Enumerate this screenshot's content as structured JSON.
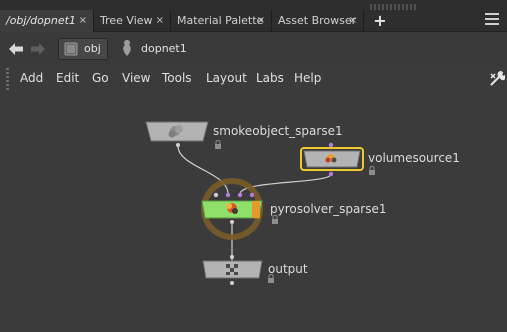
{
  "tabs": [
    {
      "label": "/obj/dopnet1",
      "close": "×",
      "active": true
    },
    {
      "label": "Tree View",
      "close": "×",
      "active": false
    },
    {
      "label": "Material Palette",
      "close": "×",
      "active": false
    },
    {
      "label": "Asset Browser",
      "close": "×",
      "active": false
    }
  ],
  "add_tab_label": "+",
  "path": {
    "segments": [
      {
        "label": "obj",
        "icon": "object-network-icon"
      },
      {
        "label": "dopnet1",
        "icon": "dop-network-icon"
      }
    ]
  },
  "menu": [
    "Add",
    "Edit",
    "Go",
    "View",
    "Tools",
    "Layout",
    "Labs",
    "Help"
  ],
  "nodes": {
    "smokeobject": {
      "label": "smokeobject_sparse1",
      "icon": "smoke-object-icon"
    },
    "volumesource": {
      "label": "volumesource1",
      "icon": "volume-source-icon",
      "selected": true
    },
    "pyrosolver": {
      "label": "pyrosolver_sparse1",
      "icon": "pyro-solver-icon",
      "display_flag": true
    },
    "output": {
      "label": "output",
      "icon": "output-icon"
    }
  },
  "colors": {
    "selected_outline": "#f0c92e",
    "solver_green": "#8ee06a",
    "connector_purple": "#b77bd8",
    "display_ring": "#8a6a2a",
    "node_gray": "#b0b0b0"
  }
}
